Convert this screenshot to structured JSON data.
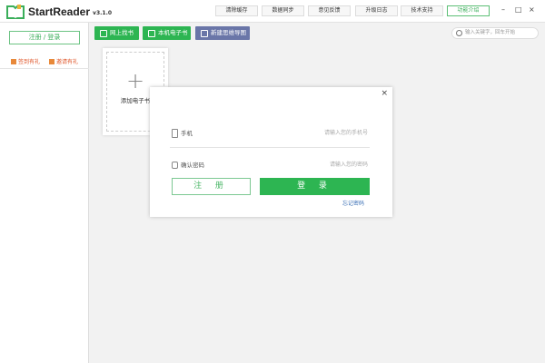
{
  "app": {
    "name": "StartReader",
    "version": "v3.1.0"
  },
  "toolbar": [
    "清除缓存",
    "数据同步",
    "意见反馈",
    "升级日志",
    "技术支持",
    "功能介绍"
  ],
  "window": {
    "minimize": "–",
    "maximize": "□",
    "close": "×"
  },
  "sidebar": {
    "login": "注册 / 登录",
    "checkin": "签到有礼",
    "invite": "邀请有礼"
  },
  "actions": [
    "网上找书",
    "本机电子书",
    "新建思维导图"
  ],
  "search": {
    "placeholder": "输入关键字，回车开始"
  },
  "card": {
    "plus": "+",
    "label": "添加电子书"
  },
  "dialog": {
    "close": "×",
    "phone_label": "手机",
    "phone_placeholder": "请输入您的手机号",
    "pwd_label": "确认密码",
    "pwd_placeholder": "请输入您的密码",
    "register": "注 册",
    "login": "登 录",
    "forgot": "忘记密码"
  },
  "colors": {
    "green": "#2db552",
    "purple": "#6a76a8"
  }
}
